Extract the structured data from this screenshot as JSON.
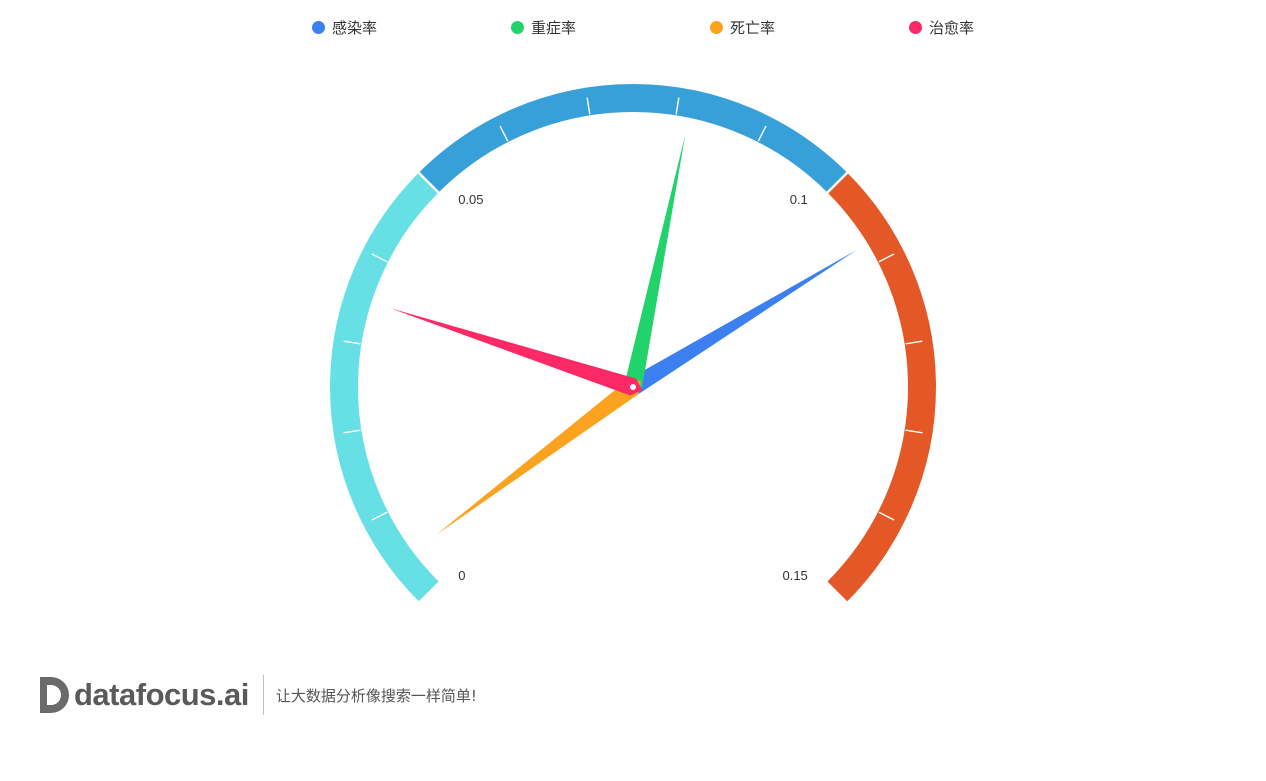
{
  "legend": {
    "items": [
      {
        "label": "感染率",
        "color": "#3b7ff0"
      },
      {
        "label": "重症率",
        "color": "#21d36a"
      },
      {
        "label": "死亡率",
        "color": "#fba31e"
      },
      {
        "label": "治愈率",
        "color": "#fb2965"
      }
    ]
  },
  "chart_data": {
    "type": "gauge",
    "min": 0,
    "max": 0.15,
    "tick_labels": [
      "0",
      "0.05",
      "0.1",
      "0.15"
    ],
    "bands": [
      {
        "from": 0,
        "to": 0.05,
        "color": "#66e0e4"
      },
      {
        "from": 0.05,
        "to": 0.1,
        "color": "#38a0d8"
      },
      {
        "from": 0.1,
        "to": 0.15,
        "color": "#e35826"
      }
    ],
    "series": [
      {
        "name": "感染率",
        "value": 0.1075,
        "color": "#3b7ff0"
      },
      {
        "name": "重症率",
        "value": 0.0815,
        "color": "#21d36a"
      },
      {
        "name": "死亡率",
        "value": 0.0045,
        "color": "#fba31e"
      },
      {
        "name": "治愈率",
        "value": 0.035,
        "color": "#fb2965"
      }
    ]
  },
  "footer": {
    "brand": "datafocus.ai",
    "slogan": "让大数据分析像搜索一样简单!"
  }
}
